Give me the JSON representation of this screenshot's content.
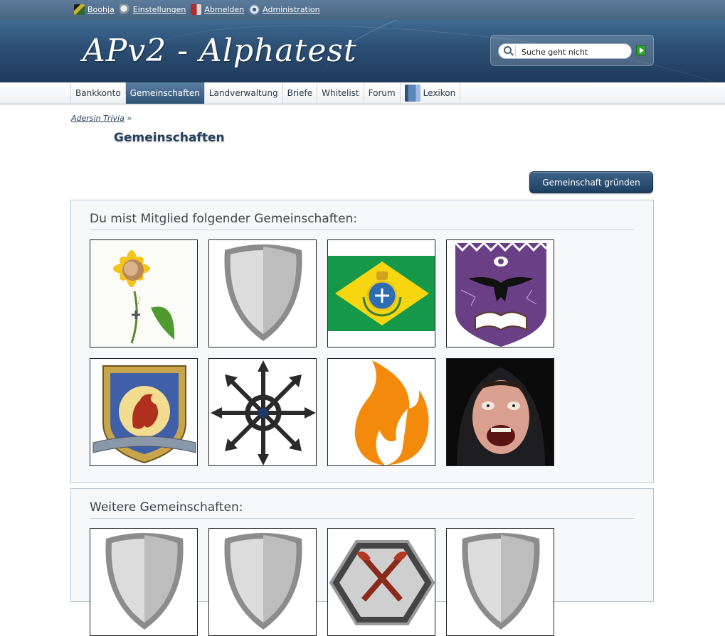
{
  "userbar": {
    "username": "Boohja",
    "settings": "Einstellungen",
    "logout": "Abmelden",
    "admin": "Administration"
  },
  "header": {
    "title": "APv2 - Alphatest",
    "search_value": "Suche geht nicht"
  },
  "nav": {
    "tabs": [
      "Bankkonto",
      "Gemeinschaften",
      "Landverwaltung",
      "Briefe",
      "Whitelist",
      "Forum",
      "Lexikon"
    ],
    "active": "Gemeinschaften"
  },
  "breadcrumb": {
    "link": "Adersin Trivia",
    "separator": "»"
  },
  "page": {
    "title": "Gemeinschaften",
    "create_button": "Gemeinschaft gründen"
  },
  "sections": {
    "member_heading": "Du mist Mitglied folgender Gemeinschaften:",
    "more_heading": "Weitere Gemeinschaften:"
  },
  "member_communities": [
    "sunflower-emblem",
    "silver-shield",
    "green-yellow-flag",
    "purple-raven-crest",
    "griffin-crest",
    "chaos-star",
    "orange-flame",
    "screaming-face-photo"
  ],
  "more_communities": [
    "silver-shield",
    "silver-shield",
    "hexagon-axes-crest",
    "silver-shield"
  ]
}
